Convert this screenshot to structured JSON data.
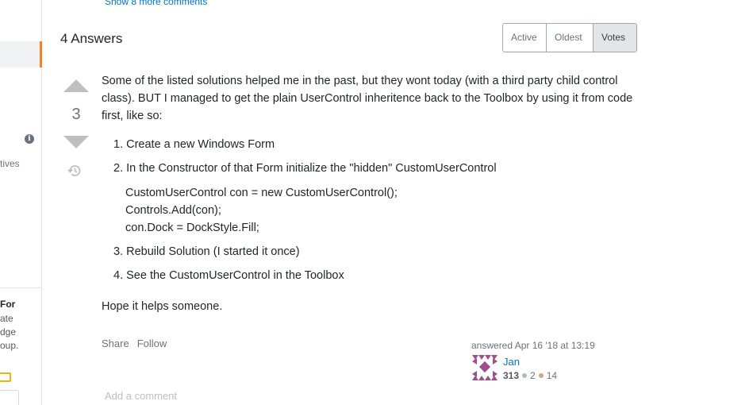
{
  "top": {
    "show_more_comments": "Show 8 more comments"
  },
  "sidebar": {
    "fragment_lives": "tives",
    "teams_title": "For",
    "teams_lines": [
      "ate",
      "dge",
      "oup."
    ],
    "info_glyph": "i"
  },
  "answers": {
    "header": "4 Answers",
    "sort_options": [
      {
        "label": "Active",
        "selected": false
      },
      {
        "label": "Oldest",
        "selected": false
      },
      {
        "label": "Votes",
        "selected": true
      }
    ]
  },
  "answer": {
    "votes": "3",
    "intro": "Some of the listed solutions helped me in the past, but they wont today (with a third party child control class). BUT I managed to get the plain UserControl inheritence back to the Toolbox by using it from code first, like so:",
    "steps": [
      "1. Create a new Windows Form",
      "2. In the Constructor of that Form initialize the \"hidden\" CustomUserControl",
      "3. Rebuild Solution (I started it once)",
      "4. See the CustomUserControl in the Toolbox"
    ],
    "code": [
      "CustomUserControl con = new CustomUserControl();",
      "Controls.Add(con);",
      "con.Dock = DockStyle.Fill;"
    ],
    "closing": "Hope it helps someone.",
    "menu": {
      "share": "Share",
      "follow": "Follow"
    },
    "user_card": {
      "answered": "answered Apr 16 '18 at 13:19",
      "name": "Jan",
      "reputation": "313",
      "silver_badges": "2",
      "bronze_badges": "14"
    },
    "add_comment": "Add a comment"
  },
  "colors": {
    "accent_orange": "#f48225",
    "link_blue": "#0074cc",
    "vote_arrow": "#bbc0c4"
  }
}
